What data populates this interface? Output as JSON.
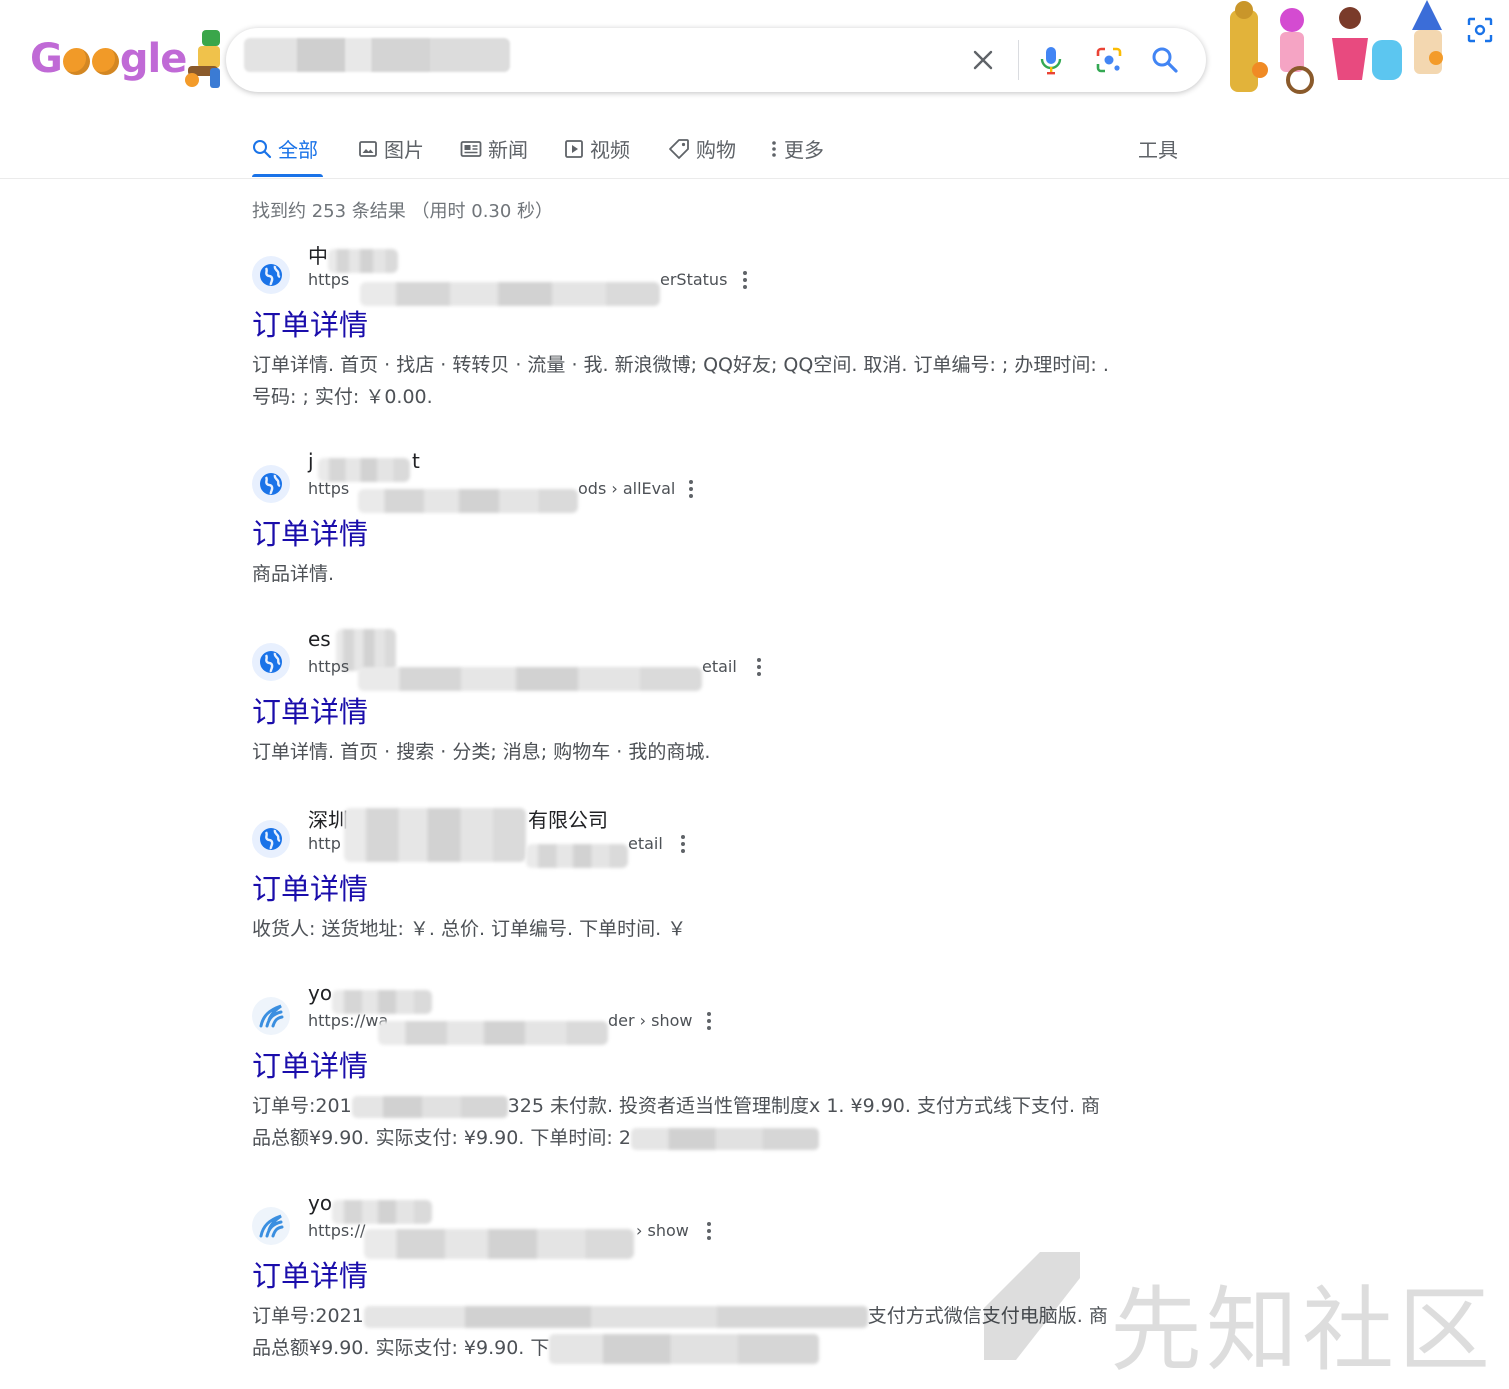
{
  "search": {
    "query_obscured": true
  },
  "logo": {
    "text": "Google"
  },
  "tabs": [
    {
      "label": "全部",
      "icon": "search-icon",
      "active": true
    },
    {
      "label": "图片",
      "icon": "image-icon"
    },
    {
      "label": "新闻",
      "icon": "news-icon"
    },
    {
      "label": "视频",
      "icon": "video-icon"
    },
    {
      "label": "购物",
      "icon": "tag-icon"
    },
    {
      "label": "更多",
      "icon": "more-vertical-icon"
    }
  ],
  "tools_label": "工具",
  "stats": "找到约 253 条结果 （用时 0.30 秒）",
  "results": [
    {
      "site": "中",
      "url_start": "https",
      "url_end": "erStatus",
      "title": "订单详情",
      "snippet": "订单详情. 首页 · 找店 · 转转贝 · 流量 · 我. 新浪微博; QQ好友; QQ空间. 取消. 订单编号: ; 办理时间: . 号码: ; 实付: ￥0.00."
    },
    {
      "site": "j",
      "site_end": "t",
      "url_start": "https",
      "url_end": "ods › allEval",
      "title": "订单详情",
      "snippet": "商品详情."
    },
    {
      "site": "es",
      "url_start": "https",
      "url_end": "etail",
      "title": "订单详情",
      "snippet": "订单详情. 首页 · 搜索 · 分类; 消息; 购物车 · 我的商城."
    },
    {
      "site": "深圳",
      "site_end": "有限公司",
      "url_start": "http",
      "url_end": "etail",
      "title": "订单详情",
      "snippet": "收货人: 送货地址: ￥. 总价. 订单编号. 下单时间. ￥"
    },
    {
      "site": "yo",
      "url_start": "https://wa",
      "url_end": "der › show",
      "title": "订单详情",
      "snippet_a": "订单号:201",
      "snippet_b": "325 未付款. 投资者适当性管理制度x 1. ¥9.90. 支付方式线下支付. 商品总额¥9.90. 实际支付: ¥9.90. 下单时间: 2"
    },
    {
      "site": "yo",
      "url_start": "https://",
      "url_end": "› show",
      "title": "订单详情",
      "snippet_a": "订单号:2021",
      "snippet_b": "支付方式微信支付电脑版. 商品总额¥9.90. 实际支付: ¥9.90. 下"
    }
  ],
  "watermark": {
    "text": "先知社区"
  },
  "colors": {
    "link": "#1a0dab",
    "accent": "#1a73e8",
    "snippet": "#4d5156"
  }
}
